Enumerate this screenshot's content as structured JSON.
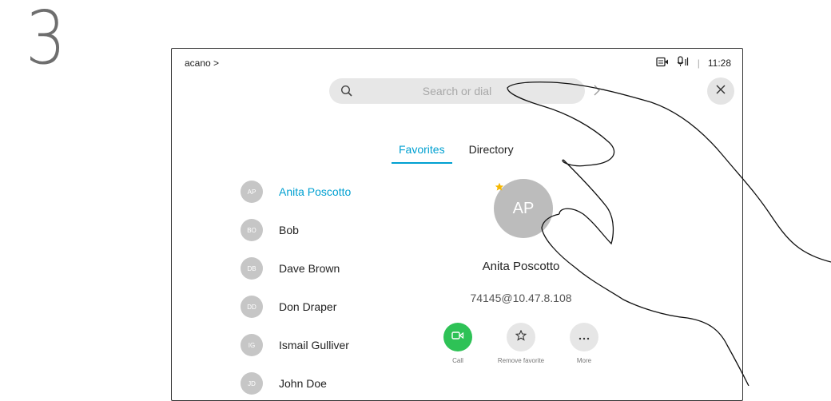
{
  "step_number": "3",
  "header": {
    "breadcrumb": "acano >",
    "time": "11:28",
    "separator": "|"
  },
  "search": {
    "placeholder": "Search or dial"
  },
  "tabs": [
    {
      "label": "Favorites",
      "active": true
    },
    {
      "label": "Directory",
      "active": false
    }
  ],
  "contacts": [
    {
      "initials": "AP",
      "name": "Anita Poscotto",
      "selected": true
    },
    {
      "initials": "BO",
      "name": "Bob"
    },
    {
      "initials": "DB",
      "name": "Dave Brown"
    },
    {
      "initials": "DD",
      "name": "Don Draper"
    },
    {
      "initials": "IG",
      "name": "Ismail Gulliver"
    },
    {
      "initials": "JD",
      "name": "John Doe"
    }
  ],
  "detail": {
    "initials": "AP",
    "name": "Anita Poscotto",
    "address": "74145@10.47.8.108"
  },
  "actions": [
    {
      "label": "Call",
      "icon": "video-camera-icon",
      "color": "#2ec256"
    },
    {
      "label": "Remove favorite",
      "icon": "star-outline-icon",
      "color": "#e6e6e6"
    },
    {
      "label": "More",
      "icon": "ellipsis-icon",
      "color": "#e6e6e6"
    }
  ],
  "colors": {
    "accent": "#00a0d1",
    "call_green": "#2ec256",
    "favorite_star": "#f5b700"
  }
}
